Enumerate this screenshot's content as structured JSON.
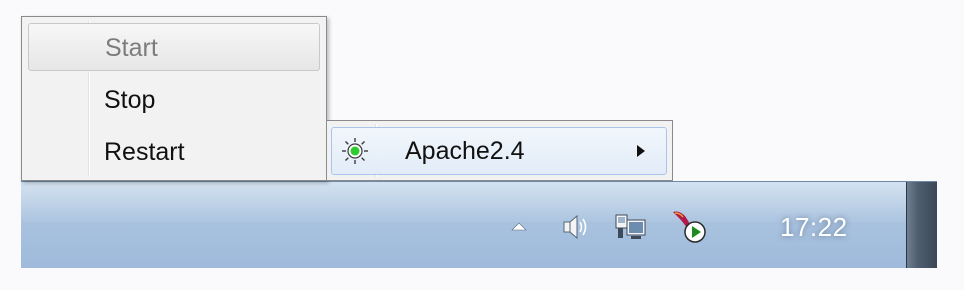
{
  "context_menu": {
    "items": [
      {
        "label": "Start",
        "enabled": false
      },
      {
        "label": "Stop",
        "enabled": true
      },
      {
        "label": "Restart",
        "enabled": true
      }
    ]
  },
  "services_menu": {
    "item": {
      "label": "Apache2.4",
      "status_icon": "running-light-icon",
      "status_color": "#2ecc2e",
      "has_submenu": true
    }
  },
  "taskbar": {
    "tray_icons": [
      "show-hidden-icons-arrow",
      "volume-icon",
      "network-icon",
      "apache-monitor-icon"
    ],
    "clock": "17:22",
    "accent_color": "#a9c3df"
  }
}
